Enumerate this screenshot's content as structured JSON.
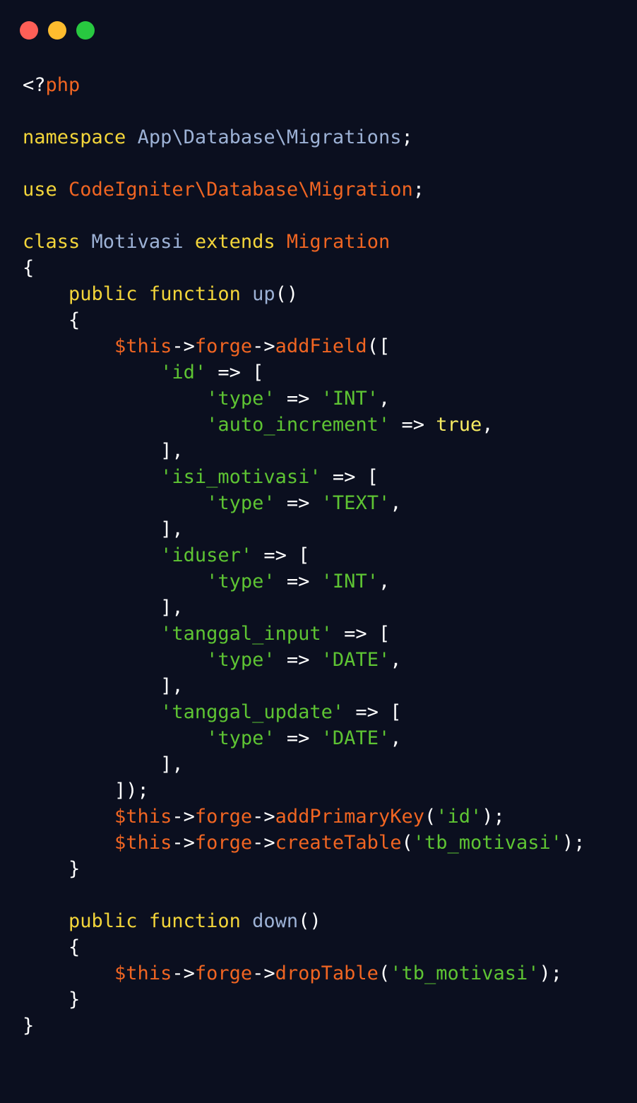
{
  "window": {
    "traffic_lights": [
      {
        "name": "close",
        "color": "#fe5f57"
      },
      {
        "name": "minimize",
        "color": "#febc2e"
      },
      {
        "name": "zoom",
        "color": "#28c840"
      }
    ]
  },
  "colors": {
    "background": "#0b0f1f",
    "keyword": "#f3d53a",
    "namespace": "#9db2d6",
    "variable_method": "#f06522",
    "string": "#5ec433",
    "plain": "#ffffff"
  },
  "code": {
    "lines": [
      [
        {
          "t": "<?",
          "c": "plain"
        },
        {
          "t": "php",
          "c": "orange"
        }
      ],
      [],
      [
        {
          "t": "namespace",
          "c": "kw"
        },
        {
          "t": " ",
          "c": "plain"
        },
        {
          "t": "App\\Database\\Migrations",
          "c": "ns"
        },
        {
          "t": ";",
          "c": "plain"
        }
      ],
      [],
      [
        {
          "t": "use",
          "c": "kw"
        },
        {
          "t": " ",
          "c": "plain"
        },
        {
          "t": "CodeIgniter\\Database\\Migration",
          "c": "orange"
        },
        {
          "t": ";",
          "c": "plain"
        }
      ],
      [],
      [
        {
          "t": "class",
          "c": "kw"
        },
        {
          "t": " ",
          "c": "plain"
        },
        {
          "t": "Motivasi",
          "c": "ns"
        },
        {
          "t": " ",
          "c": "plain"
        },
        {
          "t": "extends",
          "c": "kw"
        },
        {
          "t": " ",
          "c": "plain"
        },
        {
          "t": "Migration",
          "c": "orange"
        }
      ],
      [
        {
          "t": "{",
          "c": "plain"
        }
      ],
      [
        {
          "t": "    ",
          "c": "plain"
        },
        {
          "t": "public",
          "c": "kw"
        },
        {
          "t": " ",
          "c": "plain"
        },
        {
          "t": "function",
          "c": "kw"
        },
        {
          "t": " ",
          "c": "plain"
        },
        {
          "t": "up",
          "c": "fn"
        },
        {
          "t": "()",
          "c": "plain"
        }
      ],
      [
        {
          "t": "    {",
          "c": "plain"
        }
      ],
      [
        {
          "t": "        ",
          "c": "plain"
        },
        {
          "t": "$this",
          "c": "orange"
        },
        {
          "t": "->",
          "c": "plain"
        },
        {
          "t": "forge",
          "c": "orange"
        },
        {
          "t": "->",
          "c": "plain"
        },
        {
          "t": "addField",
          "c": "orange"
        },
        {
          "t": "([",
          "c": "plain"
        }
      ],
      [
        {
          "t": "            ",
          "c": "plain"
        },
        {
          "t": "'id'",
          "c": "str"
        },
        {
          "t": " => [",
          "c": "plain"
        }
      ],
      [
        {
          "t": "                ",
          "c": "plain"
        },
        {
          "t": "'type'",
          "c": "str"
        },
        {
          "t": " => ",
          "c": "plain"
        },
        {
          "t": "'INT'",
          "c": "str"
        },
        {
          "t": ",",
          "c": "plain"
        }
      ],
      [
        {
          "t": "                ",
          "c": "plain"
        },
        {
          "t": "'auto_increment'",
          "c": "str"
        },
        {
          "t": " => ",
          "c": "plain"
        },
        {
          "t": "true",
          "c": "bool"
        },
        {
          "t": ",",
          "c": "plain"
        }
      ],
      [
        {
          "t": "            ],",
          "c": "plain"
        }
      ],
      [
        {
          "t": "            ",
          "c": "plain"
        },
        {
          "t": "'isi_motivasi'",
          "c": "str"
        },
        {
          "t": " => [",
          "c": "plain"
        }
      ],
      [
        {
          "t": "                ",
          "c": "plain"
        },
        {
          "t": "'type'",
          "c": "str"
        },
        {
          "t": " => ",
          "c": "plain"
        },
        {
          "t": "'TEXT'",
          "c": "str"
        },
        {
          "t": ",",
          "c": "plain"
        }
      ],
      [
        {
          "t": "            ],",
          "c": "plain"
        }
      ],
      [
        {
          "t": "            ",
          "c": "plain"
        },
        {
          "t": "'iduser'",
          "c": "str"
        },
        {
          "t": " => [",
          "c": "plain"
        }
      ],
      [
        {
          "t": "                ",
          "c": "plain"
        },
        {
          "t": "'type'",
          "c": "str"
        },
        {
          "t": " => ",
          "c": "plain"
        },
        {
          "t": "'INT'",
          "c": "str"
        },
        {
          "t": ",",
          "c": "plain"
        }
      ],
      [
        {
          "t": "            ],",
          "c": "plain"
        }
      ],
      [
        {
          "t": "            ",
          "c": "plain"
        },
        {
          "t": "'tanggal_input'",
          "c": "str"
        },
        {
          "t": " => [",
          "c": "plain"
        }
      ],
      [
        {
          "t": "                ",
          "c": "plain"
        },
        {
          "t": "'type'",
          "c": "str"
        },
        {
          "t": " => ",
          "c": "plain"
        },
        {
          "t": "'DATE'",
          "c": "str"
        },
        {
          "t": ",",
          "c": "plain"
        }
      ],
      [
        {
          "t": "            ],",
          "c": "plain"
        }
      ],
      [
        {
          "t": "            ",
          "c": "plain"
        },
        {
          "t": "'tanggal_update'",
          "c": "str"
        },
        {
          "t": " => [",
          "c": "plain"
        }
      ],
      [
        {
          "t": "                ",
          "c": "plain"
        },
        {
          "t": "'type'",
          "c": "str"
        },
        {
          "t": " => ",
          "c": "plain"
        },
        {
          "t": "'DATE'",
          "c": "str"
        },
        {
          "t": ",",
          "c": "plain"
        }
      ],
      [
        {
          "t": "            ],",
          "c": "plain"
        }
      ],
      [
        {
          "t": "        ]);",
          "c": "plain"
        }
      ],
      [
        {
          "t": "        ",
          "c": "plain"
        },
        {
          "t": "$this",
          "c": "orange"
        },
        {
          "t": "->",
          "c": "plain"
        },
        {
          "t": "forge",
          "c": "orange"
        },
        {
          "t": "->",
          "c": "plain"
        },
        {
          "t": "addPrimaryKey",
          "c": "orange"
        },
        {
          "t": "(",
          "c": "plain"
        },
        {
          "t": "'id'",
          "c": "str"
        },
        {
          "t": ");",
          "c": "plain"
        }
      ],
      [
        {
          "t": "        ",
          "c": "plain"
        },
        {
          "t": "$this",
          "c": "orange"
        },
        {
          "t": "->",
          "c": "plain"
        },
        {
          "t": "forge",
          "c": "orange"
        },
        {
          "t": "->",
          "c": "plain"
        },
        {
          "t": "createTable",
          "c": "orange"
        },
        {
          "t": "(",
          "c": "plain"
        },
        {
          "t": "'tb_motivasi'",
          "c": "str"
        },
        {
          "t": ");",
          "c": "plain"
        }
      ],
      [
        {
          "t": "    }",
          "c": "plain"
        }
      ],
      [],
      [
        {
          "t": "    ",
          "c": "plain"
        },
        {
          "t": "public",
          "c": "kw"
        },
        {
          "t": " ",
          "c": "plain"
        },
        {
          "t": "function",
          "c": "kw"
        },
        {
          "t": " ",
          "c": "plain"
        },
        {
          "t": "down",
          "c": "fn"
        },
        {
          "t": "()",
          "c": "plain"
        }
      ],
      [
        {
          "t": "    {",
          "c": "plain"
        }
      ],
      [
        {
          "t": "        ",
          "c": "plain"
        },
        {
          "t": "$this",
          "c": "orange"
        },
        {
          "t": "->",
          "c": "plain"
        },
        {
          "t": "forge",
          "c": "orange"
        },
        {
          "t": "->",
          "c": "plain"
        },
        {
          "t": "dropTable",
          "c": "orange"
        },
        {
          "t": "(",
          "c": "plain"
        },
        {
          "t": "'tb_motivasi'",
          "c": "str"
        },
        {
          "t": ");",
          "c": "plain"
        }
      ],
      [
        {
          "t": "    }",
          "c": "plain"
        }
      ],
      [
        {
          "t": "}",
          "c": "plain"
        }
      ]
    ]
  }
}
